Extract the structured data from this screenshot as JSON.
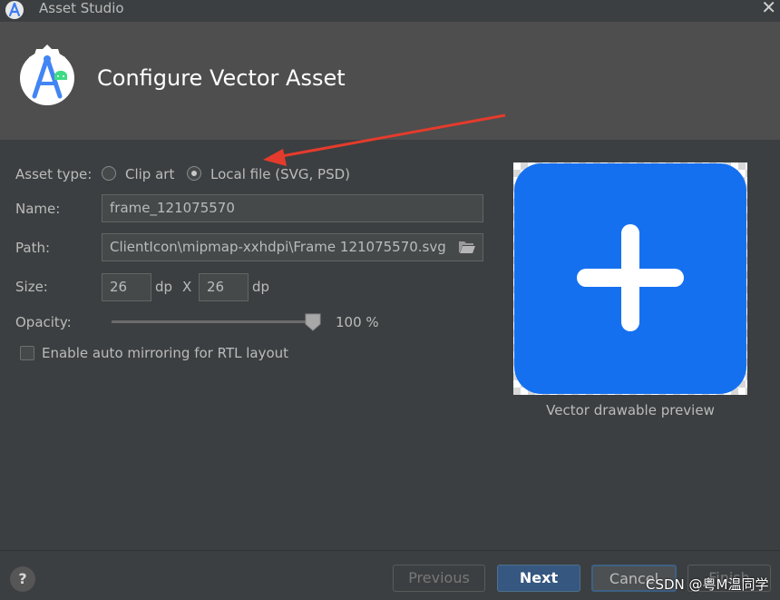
{
  "window": {
    "title": "Asset Studio",
    "close_glyph": "✕",
    "app_icon": "android-studio-icon"
  },
  "header": {
    "title": "Configure Vector Asset",
    "logo_icon": "android-studio-logo-icon"
  },
  "form": {
    "asset_type": {
      "label": "Asset type:",
      "options": [
        "Clip art",
        "Local file (SVG, PSD)"
      ],
      "selected": "Local file (SVG, PSD)"
    },
    "name": {
      "label": "Name:",
      "value": "frame_121075570"
    },
    "path": {
      "label": "Path:",
      "value": "ClientIcon\\mipmap-xxhdpi\\Frame 121075570.svg",
      "browse_icon": "folder-open-icon"
    },
    "size": {
      "label": "Size:",
      "width": "26",
      "height": "26",
      "unit": "dp",
      "separator": "X"
    },
    "opacity": {
      "label": "Opacity:",
      "value_text": "100 %",
      "value": 100
    },
    "auto_mirror": {
      "label": "Enable auto mirroring for RTL layout",
      "checked": false
    }
  },
  "preview": {
    "caption": "Vector drawable preview",
    "icon": "plus-in-rounded-square-icon",
    "fill_color": "#1570f0"
  },
  "footer": {
    "help": "?",
    "previous": "Previous",
    "next": "Next",
    "cancel": "Cancel",
    "finish": "Finish"
  },
  "watermark": "CSDN @粤M温同学",
  "colors": {
    "background": "#3c3f41",
    "header": "#4e4e4e",
    "accent_button": "#365880",
    "annotation_arrow": "#e53b2c"
  }
}
